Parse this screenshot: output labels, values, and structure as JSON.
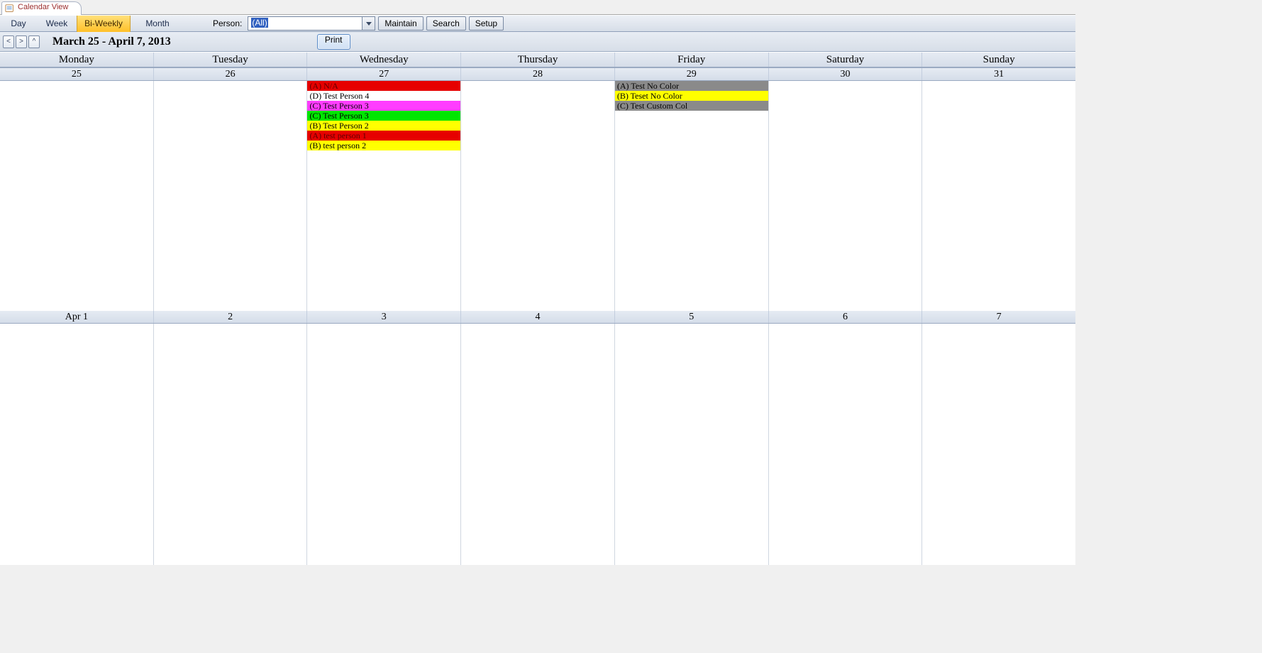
{
  "tab": {
    "title": "Calendar View"
  },
  "views": {
    "day": "Day",
    "week": "Week",
    "biweekly": "Bi-Weekly",
    "month": "Month",
    "active": "biweekly"
  },
  "personLabel": "Person:",
  "personValue": "(All)",
  "toolbar": {
    "maintain": "Maintain",
    "search": "Search",
    "setup": "Setup"
  },
  "nav": {
    "prev": "<",
    "next": ">",
    "up": "^",
    "range": "March 25 - April 7, 2013",
    "print": "Print"
  },
  "dayNames": [
    "Monday",
    "Tuesday",
    "Wednesday",
    "Thursday",
    "Friday",
    "Saturday",
    "Sunday"
  ],
  "week1Dates": [
    "25",
    "26",
    "27",
    "28",
    "29",
    "30",
    "31"
  ],
  "week2Dates": [
    "Apr 1",
    "2",
    "3",
    "4",
    "5",
    "6",
    "7"
  ],
  "events": {
    "w1d3": [
      {
        "label": "(A) N/A",
        "color": "red"
      },
      {
        "label": "(D) Test Person 4",
        "color": "white"
      },
      {
        "label": "(C) Test Person 3",
        "color": "magenta"
      },
      {
        "label": "(C) Test Person 3",
        "color": "green"
      },
      {
        "label": "(B) Test Person 2",
        "color": "yellow"
      },
      {
        "label": "(A) test person 1",
        "color": "red"
      },
      {
        "label": "(B) test person 2",
        "color": "yellow"
      }
    ],
    "w1d5": [
      {
        "label": "(A) Test No Color",
        "color": "gray"
      },
      {
        "label": "(B) Teset No Color",
        "color": "yellow"
      },
      {
        "label": "(C) Test Custom Col",
        "color": "gray"
      }
    ]
  }
}
